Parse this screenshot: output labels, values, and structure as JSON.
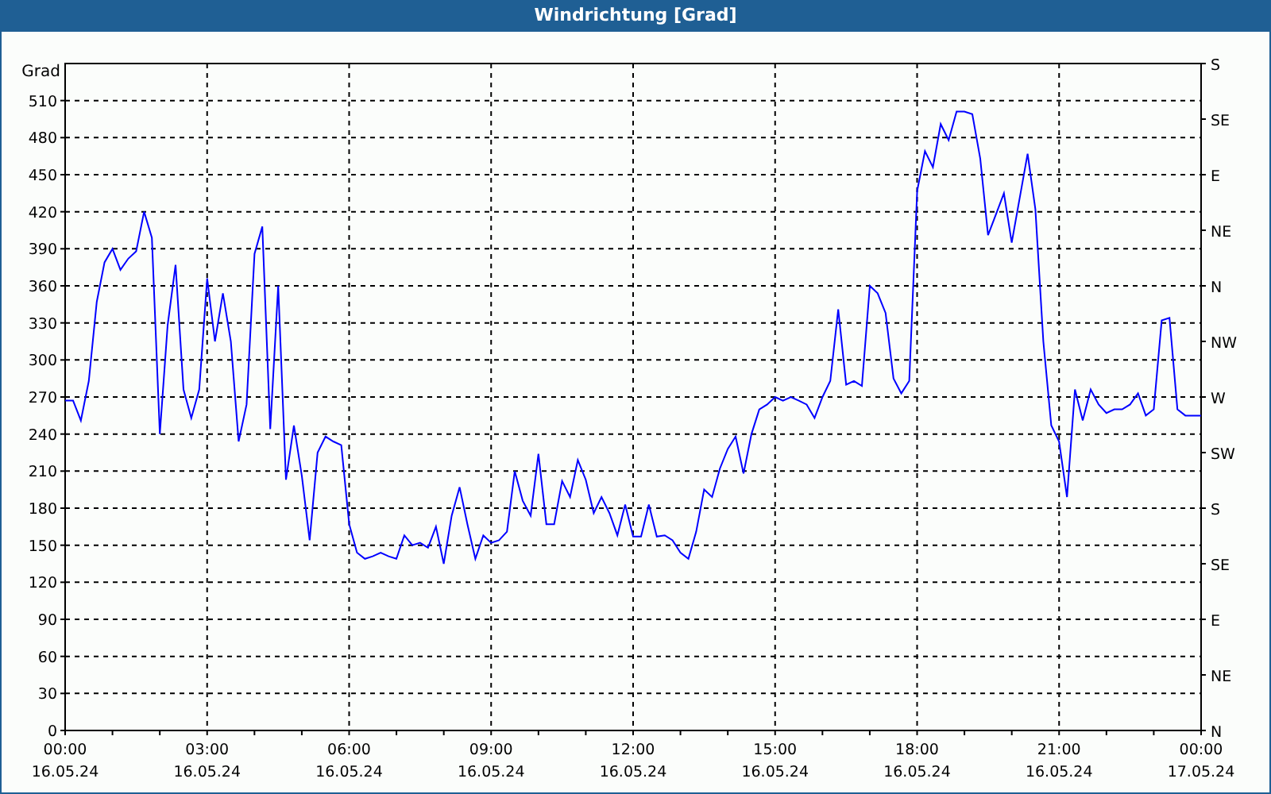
{
  "window": {
    "title": "Windrichtung [Grad]"
  },
  "chart": {
    "right_axis_labels": [
      "S",
      "SE",
      "E",
      "NE",
      "N",
      "NW",
      "W",
      "SW",
      "S",
      "SE",
      "E",
      "NE",
      "N"
    ],
    "chart_data": {
      "type": "line",
      "grid": true,
      "ylabel": "Grad",
      "ylim": [
        0,
        540
      ],
      "yticks": [
        0,
        30,
        60,
        90,
        120,
        150,
        180,
        210,
        240,
        270,
        300,
        330,
        360,
        390,
        420,
        450,
        480,
        510
      ],
      "categories": [
        "00:00\n16.05.24",
        null,
        null,
        null,
        null,
        null,
        null,
        null,
        null,
        null,
        null,
        null,
        null,
        null,
        null,
        null,
        null,
        null,
        "03:00\n16.05.24",
        null,
        null,
        null,
        null,
        null,
        null,
        null,
        null,
        null,
        null,
        null,
        null,
        null,
        null,
        null,
        null,
        null,
        "06:00\n16.05.24",
        null,
        null,
        null,
        null,
        null,
        null,
        null,
        null,
        null,
        null,
        null,
        null,
        null,
        null,
        null,
        null,
        null,
        "09:00\n16.05.24",
        null,
        null,
        null,
        null,
        null,
        null,
        null,
        null,
        null,
        null,
        null,
        null,
        null,
        null,
        null,
        null,
        null,
        "12:00\n16.05.24",
        null,
        null,
        null,
        null,
        null,
        null,
        null,
        null,
        null,
        null,
        null,
        null,
        null,
        null,
        null,
        null,
        null,
        "15:00\n16.05.24",
        null,
        null,
        null,
        null,
        null,
        null,
        null,
        null,
        null,
        null,
        null,
        null,
        null,
        null,
        null,
        null,
        null,
        "18:00\n16.05.24",
        null,
        null,
        null,
        null,
        null,
        null,
        null,
        null,
        null,
        null,
        null,
        null,
        null,
        null,
        null,
        null,
        null,
        "21:00\n16.05.24",
        null,
        null,
        null,
        null,
        null,
        null,
        null,
        null,
        null,
        null,
        null,
        null,
        null,
        null,
        null,
        null,
        null,
        "00:00\n17.05.24"
      ],
      "series": [
        {
          "color": "#0000ff",
          "values": [
            267,
            267,
            251,
            283,
            347,
            379,
            390,
            373,
            382,
            388,
            420,
            399,
            240,
            328,
            377,
            276,
            253,
            276,
            366,
            315,
            354,
            315,
            234,
            264,
            386,
            408,
            244,
            360,
            203,
            247,
            206,
            154,
            225,
            238,
            234,
            231,
            167,
            144,
            139,
            141,
            144,
            141,
            139,
            158,
            150,
            152,
            148,
            165,
            135,
            174,
            197,
            167,
            139,
            158,
            152,
            154,
            161,
            210,
            186,
            174,
            224,
            167,
            167,
            202,
            189,
            219,
            203,
            176,
            189,
            176,
            158,
            183,
            157,
            157,
            183,
            157,
            158,
            154,
            144,
            139,
            161,
            195,
            189,
            212,
            228,
            238,
            208,
            240,
            260,
            264,
            270,
            267,
            270,
            267,
            264,
            253,
            270,
            283,
            341,
            280,
            283,
            279,
            360,
            354,
            338,
            285,
            273,
            283,
            437,
            469,
            456,
            491,
            478,
            501,
            501,
            499,
            463,
            401,
            418,
            435,
            395,
            431,
            467,
            422,
            315,
            247,
            234,
            189,
            276,
            251,
            276,
            264,
            257,
            260,
            260,
            264,
            273,
            255,
            260,
            332,
            334,
            260,
            255,
            255,
            255
          ]
        }
      ]
    }
  }
}
